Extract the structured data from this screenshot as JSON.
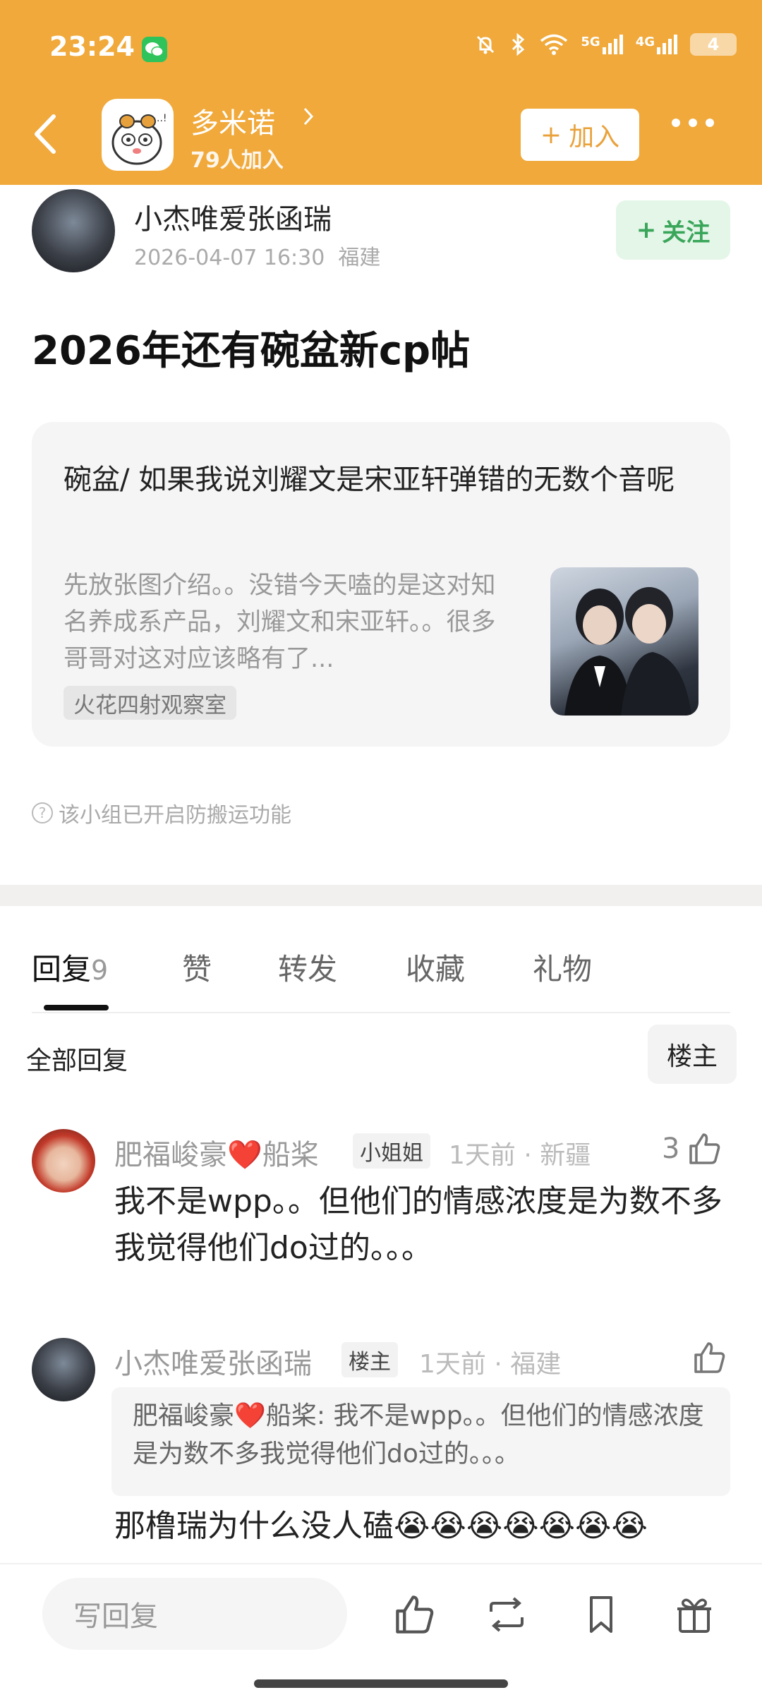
{
  "status_bar": {
    "time": "23:24",
    "battery": "4",
    "signal_labels": [
      "5G",
      "4G"
    ]
  },
  "header": {
    "group_name": "多米诺",
    "member_count": "79人加入",
    "join_label": "加入",
    "join_symbol": "+",
    "background_color": "#f0a93a"
  },
  "post": {
    "author": "小杰唯爱张函瑞",
    "date": "2026-04-07 16:30",
    "location": "福建",
    "follow_label": "关注",
    "follow_symbol": "+",
    "title": "2026年还有碗盆新cp帖",
    "quote_card": {
      "title": "碗盆/ 如果我说刘耀文是宋亚轩弹错的无数个音呢",
      "excerpt": "先放张图介绍。。没错今天嗑的是这对知名养成系产品，刘耀文和宋亚轩。。很多哥哥对这对应该略有了...",
      "tag": "火花四射观察室"
    },
    "notice": "该小组已开启防搬运功能"
  },
  "tabs": [
    {
      "label": "回复",
      "count": "9"
    },
    {
      "label": "赞"
    },
    {
      "label": "转发"
    },
    {
      "label": "收藏"
    },
    {
      "label": "礼物"
    }
  ],
  "reply_filter": {
    "all_label": "全部回复",
    "op_label": "楼主"
  },
  "comments": [
    {
      "name_prefix": "肥福峻豪",
      "name_suffix": "船桨",
      "badge": "小姐姐",
      "time": "1天前",
      "location": "新疆",
      "likes": "3",
      "text": "我不是wpp。。但他们的情感浓度是为数不多我觉得他们do过的。。。"
    },
    {
      "name": "小杰唯爱张函瑞",
      "badge": "楼主",
      "time": "1天前",
      "location": "福建",
      "quoted_author_prefix": "肥福峻豪",
      "quoted_author_suffix": "船桨:",
      "quoted_text": "我不是wpp。。但他们的情感浓度是为数不多我觉得他们do过的。。。",
      "text": "那橹瑞为什么没人磕😭😭😭😭😭😭😭"
    }
  ],
  "bottom_bar": {
    "reply_placeholder": "写回复"
  },
  "icons": {
    "heart": "❤️",
    "separator": "·"
  }
}
